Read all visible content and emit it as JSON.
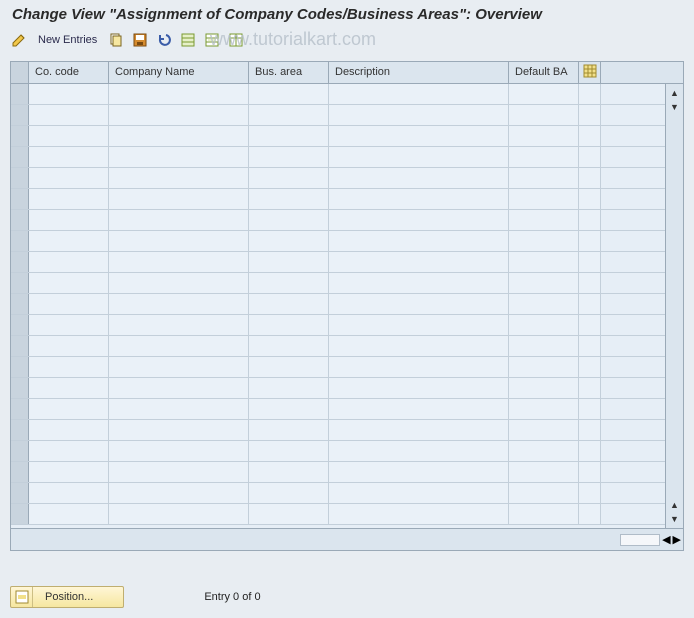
{
  "page_title": "Change View \"Assignment of Company Codes/Business Areas\": Overview",
  "toolbar": {
    "new_entries_label": "New Entries"
  },
  "watermark": "www.tutorialkart.com",
  "table": {
    "columns": {
      "selector": "",
      "co_code": "Co. code",
      "company_name": "Company Name",
      "bus_area": "Bus. area",
      "description": "Description",
      "default_ba": "Default BA"
    },
    "row_count": 21,
    "rows": []
  },
  "footer": {
    "position_label": "Position...",
    "entry_text": "Entry 0 of 0"
  }
}
